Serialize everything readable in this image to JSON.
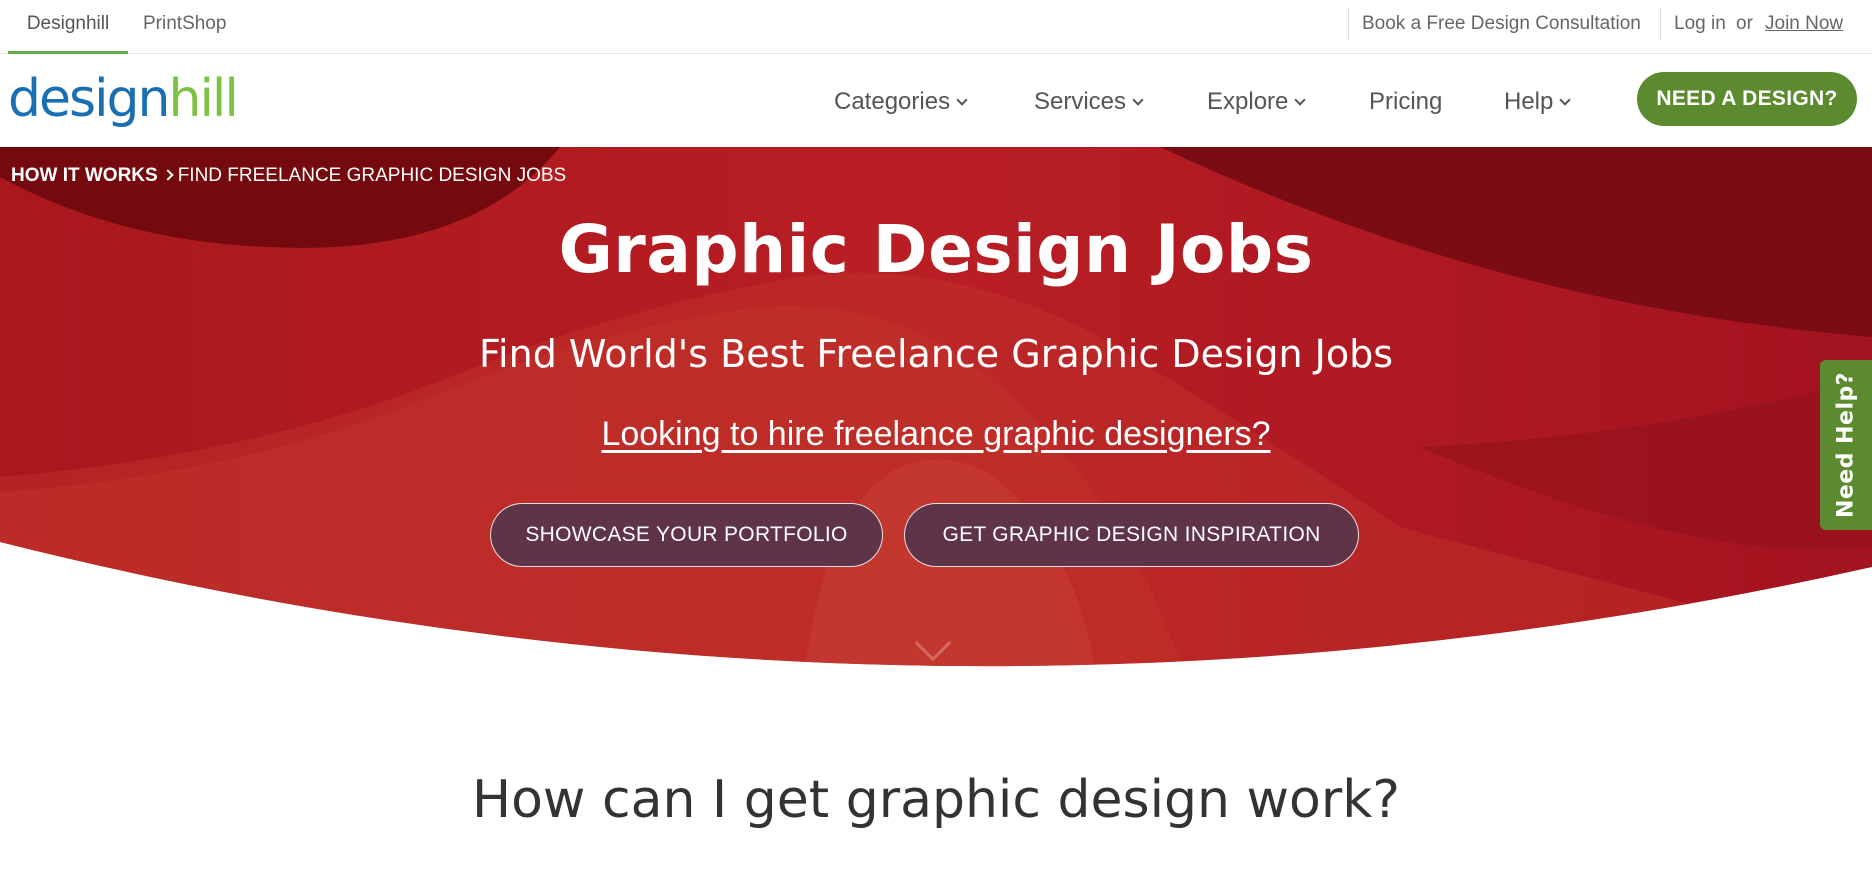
{
  "topbar": {
    "tabs": [
      {
        "label": "Designhill",
        "active": true
      },
      {
        "label": "PrintShop",
        "active": false
      }
    ],
    "consultation_link": "Book a Free Design Consultation",
    "login_link": "Log in",
    "or_text": "or",
    "join_link": "Join Now"
  },
  "header": {
    "logo": {
      "part1": "design",
      "part2": "hill"
    },
    "nav": [
      {
        "label": "Categories",
        "has_dropdown": true
      },
      {
        "label": "Services",
        "has_dropdown": true
      },
      {
        "label": "Explore",
        "has_dropdown": true
      },
      {
        "label": "Pricing",
        "has_dropdown": false
      },
      {
        "label": "Help",
        "has_dropdown": true
      }
    ],
    "cta_label": "NEED A DESIGN?"
  },
  "hero": {
    "breadcrumb": {
      "home": "HOW IT WORKS",
      "current": "FIND FREELANCE GRAPHIC DESIGN JOBS"
    },
    "title": "Graphic Design Jobs",
    "subtitle": "Find World's Best Freelance Graphic Design Jobs",
    "hire_link": "Looking to hire freelance graphic designers?",
    "buttons": [
      {
        "label": "SHOWCASE YOUR PORTFOLIO"
      },
      {
        "label": "GET GRAPHIC DESIGN INSPIRATION"
      }
    ],
    "scroll_icon": "chevron-down-icon"
  },
  "help_tab": {
    "label": "Need Help?"
  },
  "main": {
    "section_heading": "How can I get graphic design work?"
  },
  "colors": {
    "brand_green": "#5b8a2f",
    "brand_blue": "#1a6fb3",
    "hero_red": "#b5191f",
    "button_plum": "#5f3448",
    "tab_active_underline": "#6aa84f"
  }
}
